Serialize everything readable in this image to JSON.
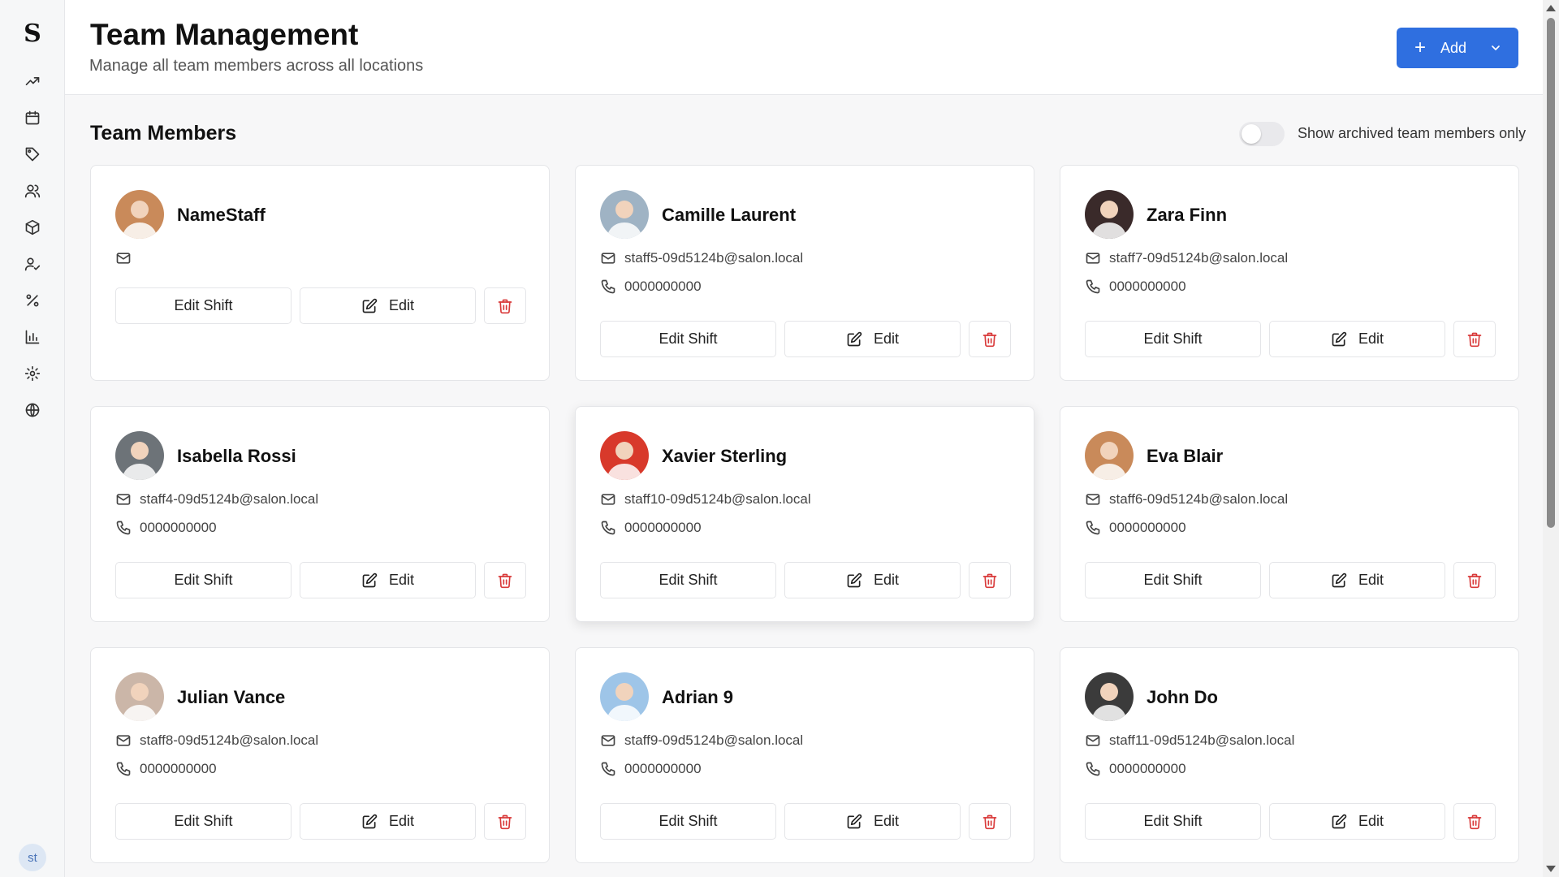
{
  "app": {
    "logo": "S",
    "user_initials": "st"
  },
  "sidebar": {
    "items": [
      {
        "icon": "trending-up-icon"
      },
      {
        "icon": "calendar-icon"
      },
      {
        "icon": "tag-icon"
      },
      {
        "icon": "users-icon"
      },
      {
        "icon": "package-icon"
      },
      {
        "icon": "user-check-icon"
      },
      {
        "icon": "percent-icon"
      },
      {
        "icon": "bar-chart-icon"
      },
      {
        "icon": "gear-icon"
      },
      {
        "icon": "globe-icon"
      }
    ]
  },
  "header": {
    "title": "Team Management",
    "subtitle": "Manage all team members across all locations",
    "add_label": "Add"
  },
  "main": {
    "section_title": "Team Members",
    "archived_toggle_label": "Show archived team members only",
    "archived_toggle_on": false,
    "edit_shift_label": "Edit Shift",
    "edit_label": "Edit",
    "members": [
      {
        "name": "NameStaff",
        "email": "",
        "phone": "",
        "avatar_color": "#c98a5a"
      },
      {
        "name": "Camille Laurent",
        "email": "staff5-09d5124b@salon.local",
        "phone": "0000000000",
        "avatar_color": "#9fb3c4"
      },
      {
        "name": "Zara Finn",
        "email": "staff7-09d5124b@salon.local",
        "phone": "0000000000",
        "avatar_color": "#3a2a2a"
      },
      {
        "name": "Isabella Rossi",
        "email": "staff4-09d5124b@salon.local",
        "phone": "0000000000",
        "avatar_color": "#6d7378"
      },
      {
        "name": "Xavier Sterling",
        "email": "staff10-09d5124b@salon.local",
        "phone": "0000000000",
        "avatar_color": "#d8392b"
      },
      {
        "name": "Eva Blair",
        "email": "staff6-09d5124b@salon.local",
        "phone": "0000000000",
        "avatar_color": "#c98a5a"
      },
      {
        "name": "Julian Vance",
        "email": "staff8-09d5124b@salon.local",
        "phone": "0000000000",
        "avatar_color": "#cbb6a8"
      },
      {
        "name": "Adrian 9",
        "email": "staff9-09d5124b@salon.local",
        "phone": "0000000000",
        "avatar_color": "#9ec5e8"
      },
      {
        "name": "John Do",
        "email": "staff11-09d5124b@salon.local",
        "phone": "0000000000",
        "avatar_color": "#3b3b3b"
      }
    ]
  }
}
